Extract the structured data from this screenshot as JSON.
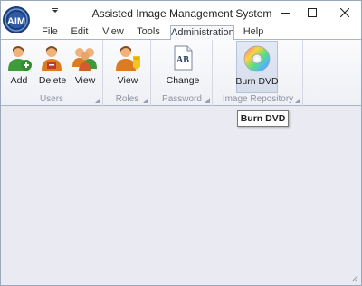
{
  "window": {
    "title": "Assisted Image Management System",
    "logo_icon": "aim-logo-icon",
    "controls": [
      "minimize-icon",
      "maximize-icon",
      "close-icon"
    ]
  },
  "tabs": [
    {
      "label": "File",
      "active": false
    },
    {
      "label": "Edit",
      "active": false
    },
    {
      "label": "View",
      "active": false
    },
    {
      "label": "Tools",
      "active": false
    },
    {
      "label": "Administration",
      "active": true
    },
    {
      "label": "Help",
      "active": false
    }
  ],
  "ribbon": {
    "groups": [
      {
        "label": "Users",
        "buttons": [
          {
            "label": "Add",
            "icon": "add-user-icon"
          },
          {
            "label": "Delete",
            "icon": "delete-user-icon"
          },
          {
            "label": "View",
            "icon": "view-users-icon"
          }
        ]
      },
      {
        "label": "Roles",
        "buttons": [
          {
            "label": "View",
            "icon": "view-roles-icon"
          }
        ]
      },
      {
        "label": "Password",
        "buttons": [
          {
            "label": "Change",
            "icon": "change-password-icon",
            "icon_text": "AB"
          }
        ]
      },
      {
        "label": "Image Repository",
        "buttons": [
          {
            "label": "Burn DVD",
            "icon": "dvd-disc-icon",
            "pressed": true
          }
        ]
      }
    ]
  },
  "tooltip": {
    "text": "Burn DVD"
  },
  "colors": {
    "window_bg": "#e9eaf2",
    "accent_border": "#aab5c6",
    "group_label": "#8b92a0"
  }
}
